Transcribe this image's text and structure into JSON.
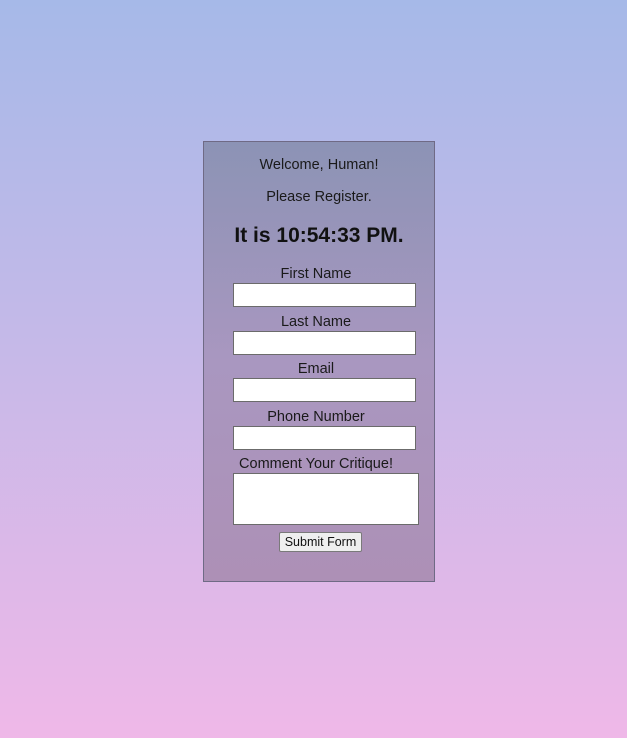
{
  "header": {
    "welcome": "Welcome, Human!",
    "register": "Please Register.",
    "clock": "It is 10:54:33 PM."
  },
  "form": {
    "first_name_label": "First Name",
    "first_name_value": "",
    "last_name_label": "Last Name",
    "last_name_value": "",
    "email_label": "Email",
    "email_value": "",
    "phone_label": "Phone Number",
    "phone_value": "",
    "comment_label": "Comment Your Critique!",
    "comment_value": "",
    "submit_label": "Submit Form"
  },
  "colors": {
    "page_gradient_top": "#a6b9e8",
    "page_gradient_bottom": "#efb8e8",
    "card_gradient_top": "#8c93b5",
    "card_gradient_bottom": "#ad90b6"
  }
}
